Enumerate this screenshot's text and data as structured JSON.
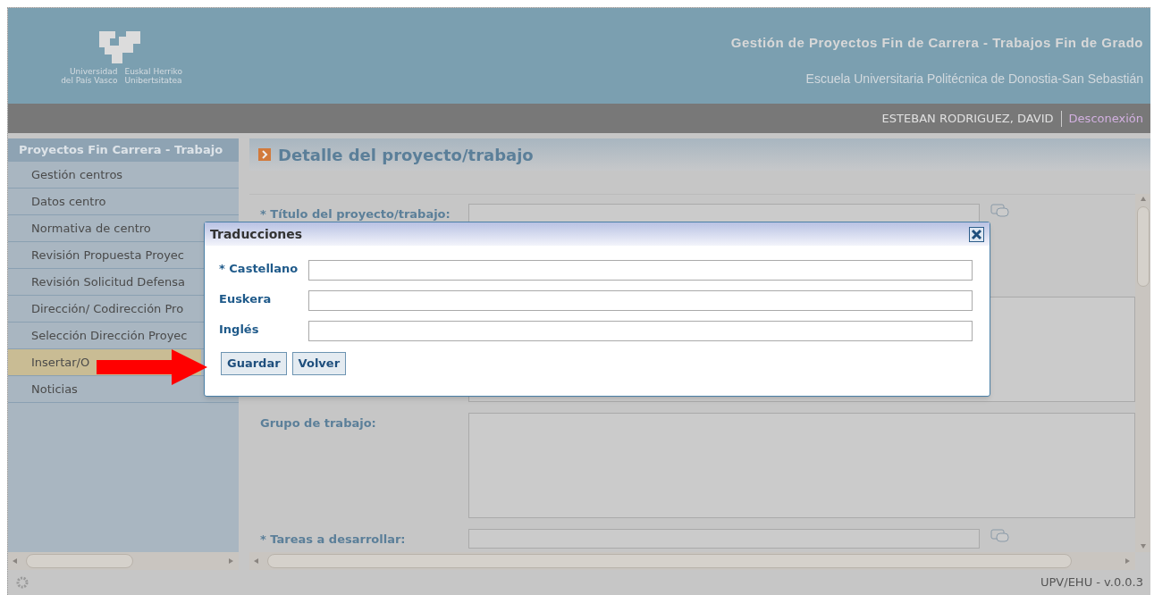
{
  "header": {
    "logo_lines": [
      "Universidad",
      "Euskal Herriko",
      "del País Vasco",
      "Unibertsitatea"
    ],
    "title": "Gestión de Proyectos Fin de Carrera - Trabajos Fin de Grado",
    "subtitle": "Escuela Universitaria Politécnica de Donostia-San Sebastián"
  },
  "user_bar": {
    "user": "ESTEBAN RODRIGUEZ, DAVID",
    "logout": "Desconexión"
  },
  "sidebar": {
    "title": "Proyectos Fin Carrera - Trabajo",
    "items": [
      {
        "label": "Gestión centros",
        "selected": false
      },
      {
        "label": "Datos centro",
        "selected": false
      },
      {
        "label": "Normativa de centro",
        "selected": false
      },
      {
        "label": "Revisión Propuesta Proyec",
        "selected": false
      },
      {
        "label": "Revisión Solicitud Defensa",
        "selected": false
      },
      {
        "label": "Dirección/ Codirección Pro",
        "selected": false
      },
      {
        "label": "Selección Dirección Proyec",
        "selected": false
      },
      {
        "label": "Insertar/O",
        "selected": true
      },
      {
        "label": "Noticias",
        "selected": false
      }
    ]
  },
  "main": {
    "title": "Detalle del proyecto/trabajo",
    "fields": [
      {
        "label": "* Título del proyecto/trabajo:",
        "kind": "line"
      },
      {
        "kind": "area"
      },
      {
        "label": "Grupo de trabajo:",
        "kind": "area"
      },
      {
        "label": "* Tareas a desarrollar:",
        "kind": "line"
      }
    ]
  },
  "dialog": {
    "title": "Traducciones",
    "fields": [
      {
        "label": "* Castellano"
      },
      {
        "label": "Euskera"
      },
      {
        "label": "Inglés"
      }
    ],
    "buttons": [
      "Guardar",
      "Volver"
    ]
  },
  "footer": {
    "version": "UPV/EHU - v.0.0.3"
  }
}
